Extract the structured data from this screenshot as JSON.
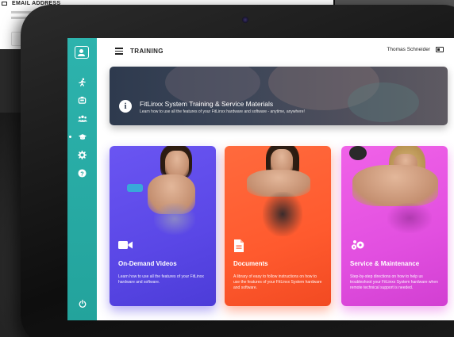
{
  "background": {
    "email_header": "EMAIL ADDRESS"
  },
  "header": {
    "title": "TRAINING",
    "user_name": "Thomas Schneider"
  },
  "sidebar": {
    "items": [
      {
        "icon": "app-logo-icon"
      },
      {
        "icon": "running-person-icon"
      },
      {
        "icon": "equipment-icon"
      },
      {
        "icon": "users-icon"
      },
      {
        "icon": "graduation-cap-icon",
        "active": true
      },
      {
        "icon": "gear-icon"
      },
      {
        "icon": "help-icon"
      },
      {
        "icon": "power-icon"
      }
    ]
  },
  "banner": {
    "title": "FitLinxx System Training & Service Materials",
    "subtitle": "Learn how to use all the features of your FitLinxx hardware and software - anytime, anywhere!"
  },
  "cards": [
    {
      "title": "On-Demand Videos",
      "description": "Learn how to use all the features of your FitLinxx hardware and software.",
      "icon": "video-camera-icon",
      "color": "#5a47e6"
    },
    {
      "title": "Documents",
      "description": "A library of easy to follow instructions on how to use the features of your FitLinxx System hardware and software.",
      "icon": "document-icon",
      "color": "#ff5a2e"
    },
    {
      "title": "Service & Maintenance",
      "description": "Step-by-step directions on how to help us troubleshoot your FitLinxx System hardware when remote technical support is needed.",
      "icon": "gears-icon",
      "color": "#e24fe0"
    }
  ]
}
